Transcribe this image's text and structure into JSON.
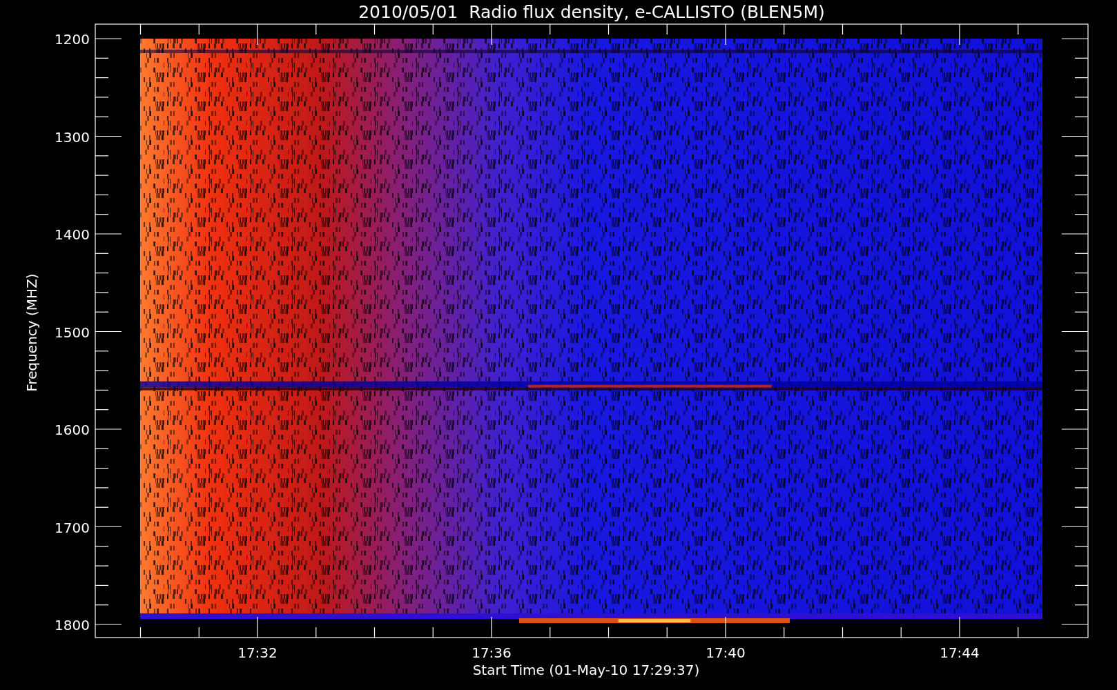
{
  "plot": {
    "title": "2010/05/01  Radio flux density, e-CALLISTO (BLEN5M)",
    "ylabel": "Frequency (MHZ)",
    "xlabel": "Start Time (01-May-10 17:29:37)",
    "yticks": [
      "1200",
      "1300",
      "1400",
      "1500",
      "1600",
      "1700",
      "1800"
    ],
    "xticks": [
      "17:32",
      "17:36",
      "17:40",
      "17:44"
    ]
  }
}
